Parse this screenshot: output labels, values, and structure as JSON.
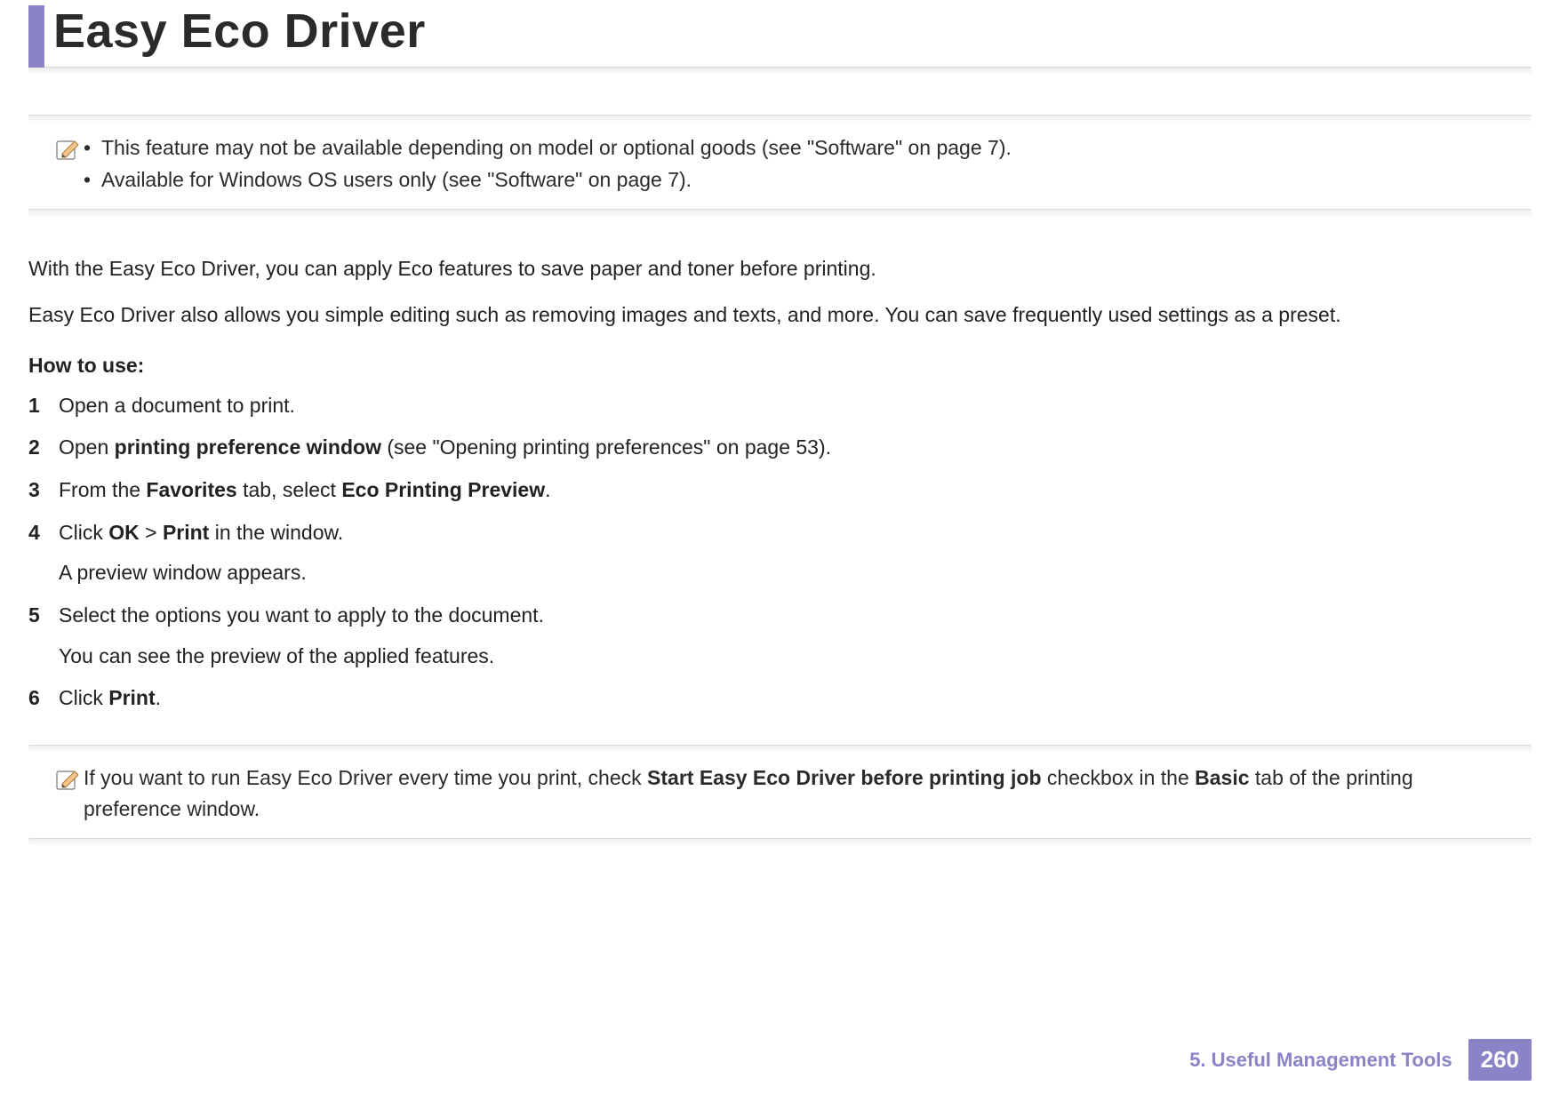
{
  "title": "Easy Eco Driver",
  "note1": {
    "bullets": [
      "This feature may not be available depending on model or optional goods (see \"Software\" on page 7).",
      "Available for Windows OS users only (see \"Software\" on page 7)."
    ]
  },
  "intro": [
    "With the Easy Eco Driver, you can apply Eco features to save paper and toner before printing.",
    "Easy Eco Driver also allows you simple editing such as removing images and texts, and more. You can save frequently used settings as a preset."
  ],
  "howto_label": "How to use:",
  "steps": {
    "s1": {
      "n": "1",
      "t": "Open a document to print."
    },
    "s2": {
      "n": "2",
      "pre": "Open ",
      "b1": "printing preference window",
      "post": " (see \"Opening printing preferences\" on page 53)."
    },
    "s3": {
      "n": "3",
      "pre": "From the ",
      "b1": "Favorites",
      "mid": " tab, select ",
      "b2": "Eco Printing Preview",
      "post": "."
    },
    "s4": {
      "n": "4",
      "pre": "Click ",
      "b1": "OK",
      "mid": " > ",
      "b2": "Print",
      "post": " in the window.",
      "sub": "A preview window appears."
    },
    "s5": {
      "n": "5",
      "t": "Select the options you want to apply to the document.",
      "sub": "You can see the preview of the applied features."
    },
    "s6": {
      "n": "6",
      "pre": "Click ",
      "b1": "Print",
      "post": "."
    }
  },
  "note2": {
    "pre": "If you want to run Easy Eco Driver every time you print, check ",
    "b1": "Start Easy Eco Driver before printing job",
    "mid": " checkbox in the ",
    "b2": "Basic",
    "post": " tab of the printing preference window."
  },
  "footer": {
    "chapter": "5.  Useful Management Tools",
    "page": "260"
  }
}
